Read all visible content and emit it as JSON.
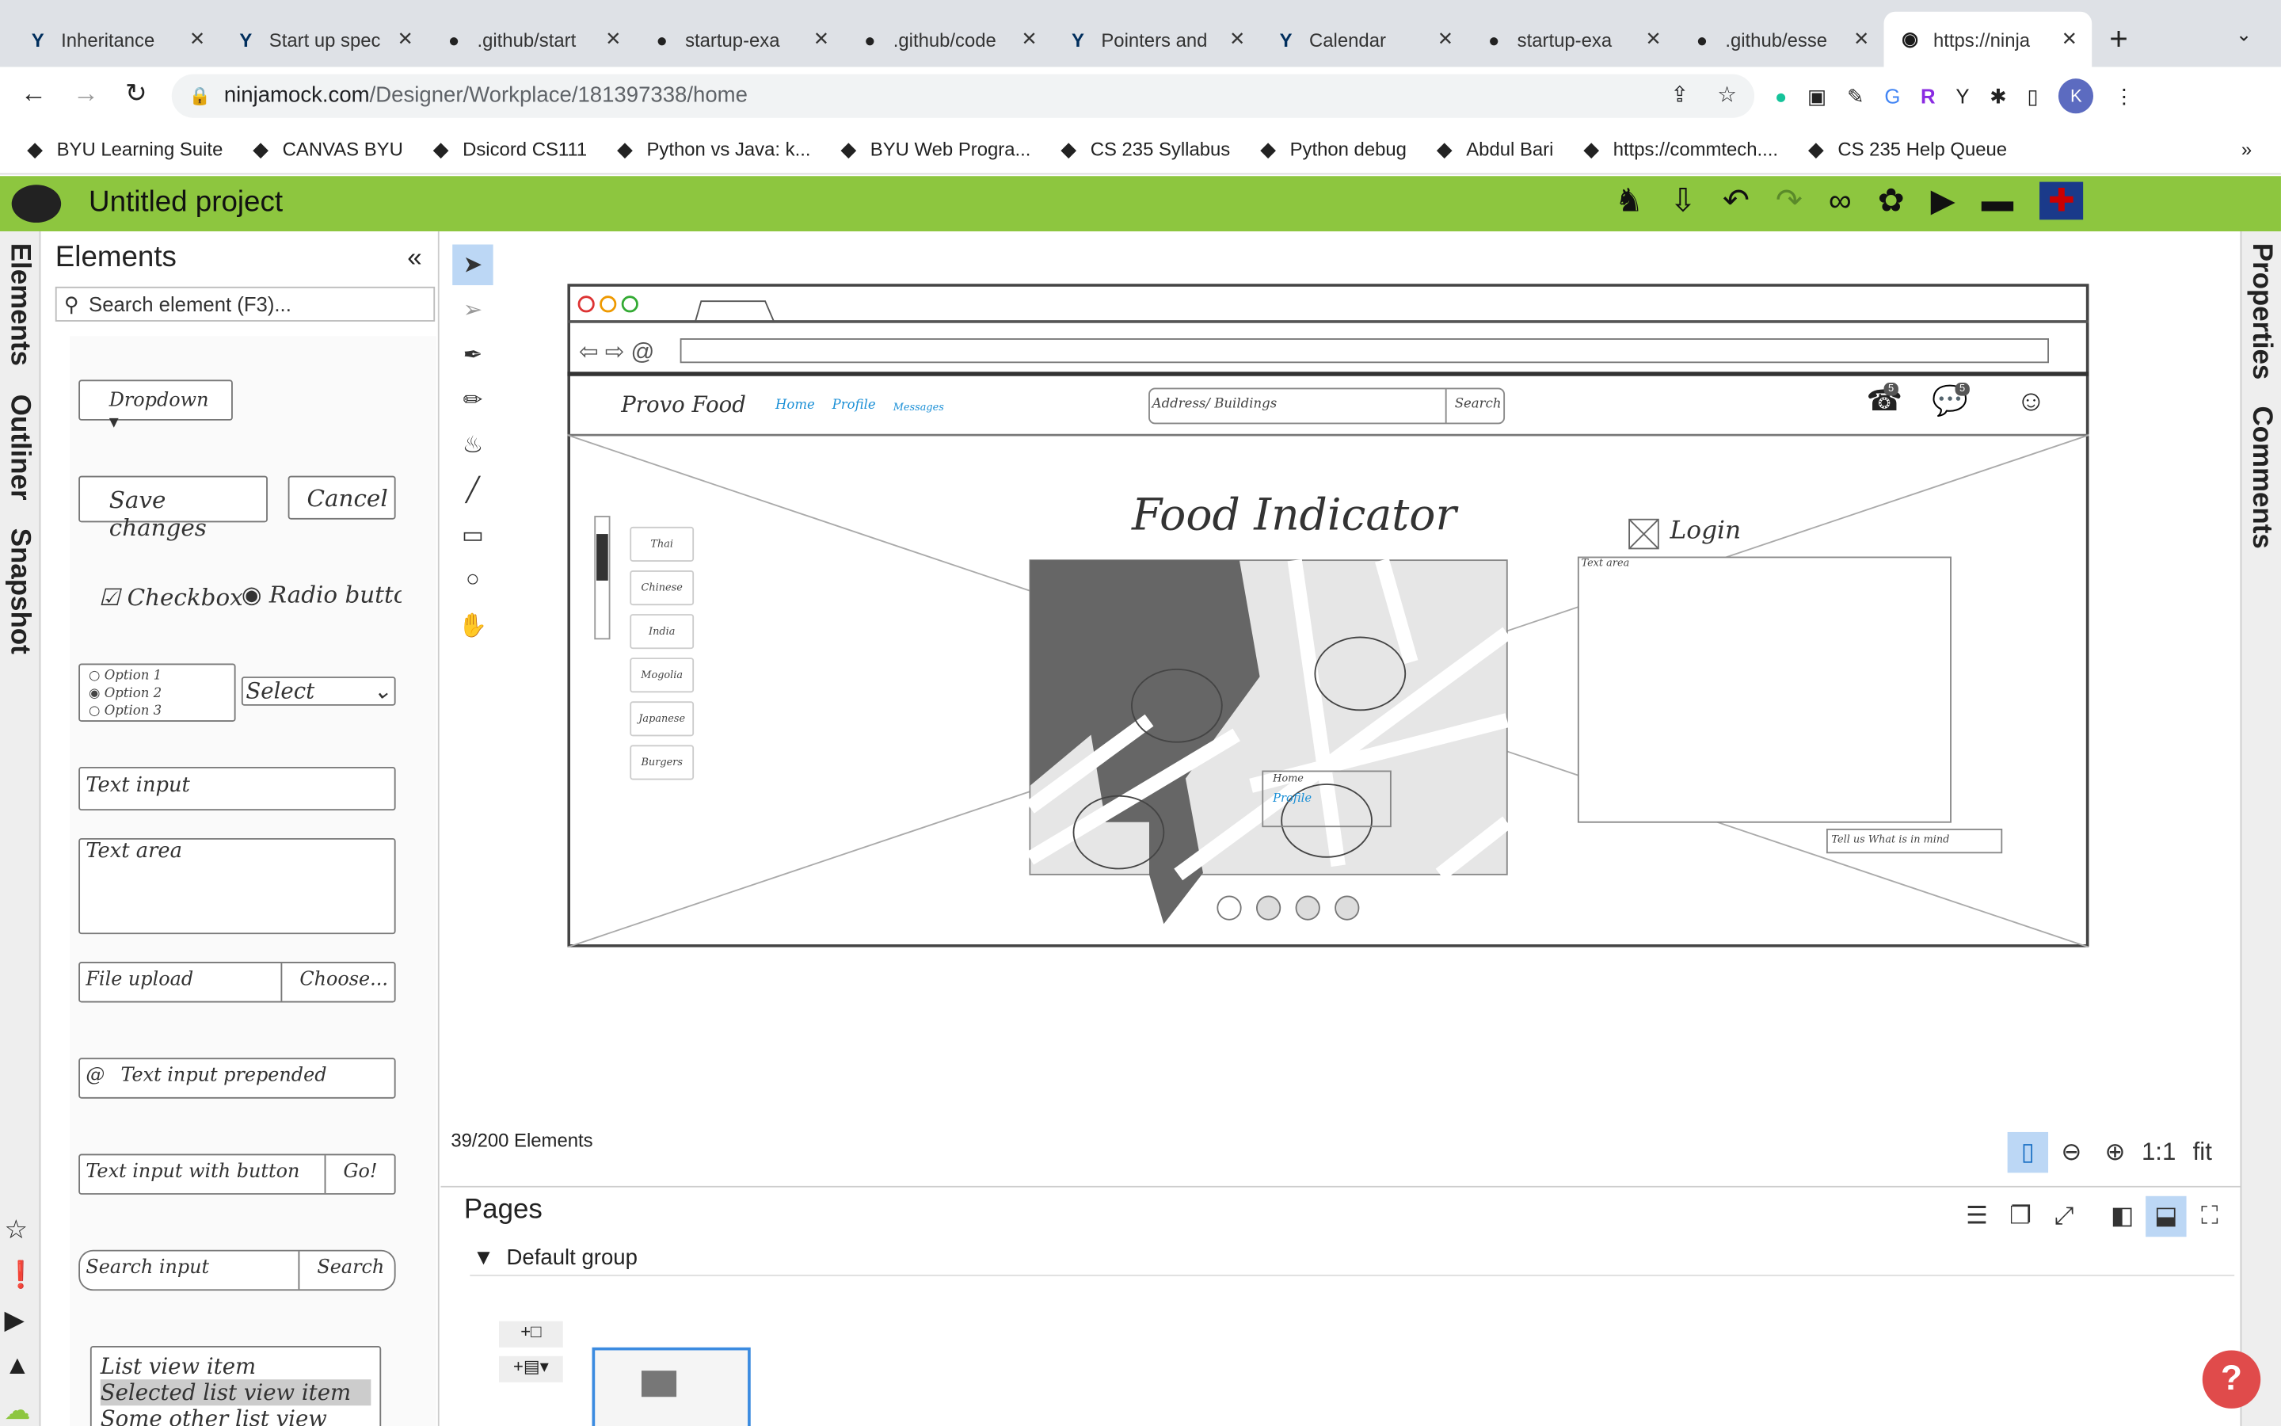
{
  "browser": {
    "tabs": [
      {
        "title": "Inheritance",
        "icon": "byu-icon"
      },
      {
        "title": "Start up spec",
        "icon": "byu-icon"
      },
      {
        "title": ".github/start",
        "icon": "github-icon"
      },
      {
        "title": "startup-exa",
        "icon": "github-icon"
      },
      {
        "title": ".github/code",
        "icon": "github-icon"
      },
      {
        "title": "Pointers and",
        "icon": "byu-icon"
      },
      {
        "title": "Calendar",
        "icon": "byu-icon"
      },
      {
        "title": "startup-exa",
        "icon": "github-icon"
      },
      {
        "title": ".github/esse",
        "icon": "github-icon"
      },
      {
        "title": "https://ninja",
        "icon": "ninjamock-icon",
        "active": true
      }
    ],
    "url_host": "ninjamock.com",
    "url_path": "/Designer/Workplace/181397338/home",
    "profile_initial": "K",
    "bookmarks": [
      "BYU Learning Suite",
      "CANVAS BYU",
      "Dsicord CS111",
      "Python vs Java: k...",
      "BYU Web Progra...",
      "CS 235 Syllabus",
      "Python debug",
      "Abdul Bari",
      "https://commtech....",
      "CS 235 Help Queue"
    ]
  },
  "app": {
    "title": "Untitled project",
    "accent": "#8dc63f",
    "left_tabs": [
      "Elements",
      "Outliner",
      "Snapshot"
    ],
    "right_tabs": [
      "Properties",
      "Comments"
    ],
    "elements_panel": {
      "title": "Elements",
      "search_placeholder": "Search element (F3)...",
      "samples": {
        "dropdown": "Dropdown",
        "save": "Save changes",
        "cancel": "Cancel",
        "checkbox": "Checkbox",
        "radio": "Radio button",
        "options": [
          "Option 1",
          "Option 2",
          "Option 3"
        ],
        "select": "Select",
        "text_input": "Text input",
        "text_area": "Text area",
        "file_upload": "File upload",
        "choose": "Choose...",
        "prepended": "Text input prepended",
        "with_button": "Text input with button",
        "go": "Go!",
        "search_input": "Search input",
        "search": "Search",
        "list": [
          "List view item",
          "Selected list view item",
          "Some other list view item"
        ]
      }
    },
    "canvas": {
      "element_count": "39/200 Elements",
      "zoom_1to1": "1:1",
      "zoom_fit": "fit",
      "mockup": {
        "brand": "Provo Food",
        "nav": [
          "Home",
          "Profile",
          "Messages"
        ],
        "search_placeholder": "Address/ Buildings",
        "search_button": "Search",
        "badges": [
          "5",
          "5"
        ],
        "title": "Food Indicator",
        "cuisines": [
          "Thai",
          "Chinese",
          "India",
          "Mogolia",
          "Japanese",
          "Burgers"
        ],
        "login": "Login",
        "textarea": "Text area",
        "input": "Tell us What is in mind",
        "menu": [
          "Home",
          "Profile"
        ]
      }
    },
    "pages": {
      "title": "Pages",
      "group": "Default group"
    }
  }
}
